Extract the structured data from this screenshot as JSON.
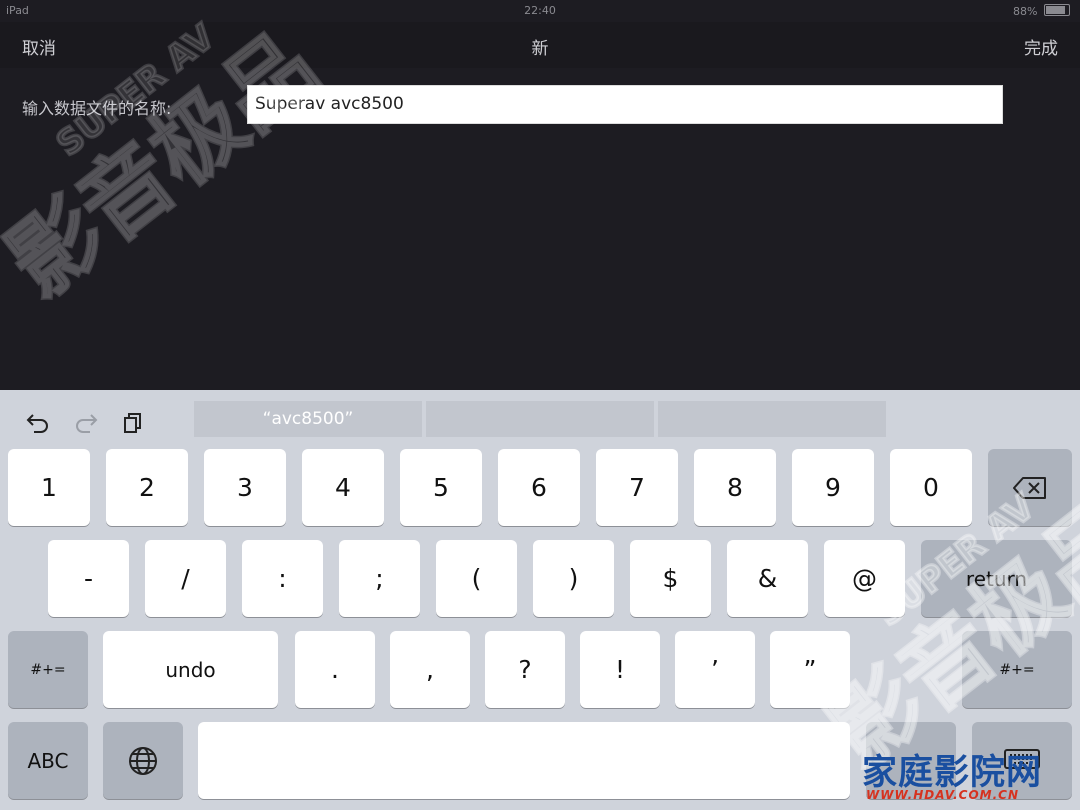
{
  "status": {
    "device": "iPad",
    "time": "22:40",
    "battery": "88%",
    "battery_level": 0.88
  },
  "nav": {
    "cancel": "取消",
    "title": "新",
    "done": "完成"
  },
  "form": {
    "label": "输入数据文件的名称:",
    "value": "Superav avc8500"
  },
  "keyboard": {
    "toolbar": {
      "undo_icon": "undo-arrow-icon",
      "redo_icon": "redo-arrow-icon",
      "paste_icon": "paste-icon"
    },
    "suggestions": [
      "“avc8500”",
      "",
      ""
    ],
    "row1": [
      "1",
      "2",
      "3",
      "4",
      "5",
      "6",
      "7",
      "8",
      "9",
      "0"
    ],
    "row2": [
      "-",
      "/",
      ":",
      ";",
      "(",
      ")",
      "$",
      "&",
      "@"
    ],
    "return_label": "return",
    "row3_left": "#+=",
    "undo_label": "undo",
    "row3": [
      ".",
      ",",
      "?",
      "!",
      "’",
      "”"
    ],
    "row3_right": "#+=",
    "abc_label": "ABC",
    "globe_icon": "globe-icon",
    "backspace_icon": "backspace-icon",
    "hide_keyboard_icon": "keyboard-icon"
  },
  "watermark": {
    "brand": "家庭影院网",
    "url": "WWW.HDAV.COM.CN",
    "overlay": "SUPER AV 影音极品"
  },
  "colors": {
    "background": "#1d1c22",
    "keyboard": "#cfd3db",
    "brand_blue": "#1a4fa0",
    "brand_red": "#d6321f"
  }
}
